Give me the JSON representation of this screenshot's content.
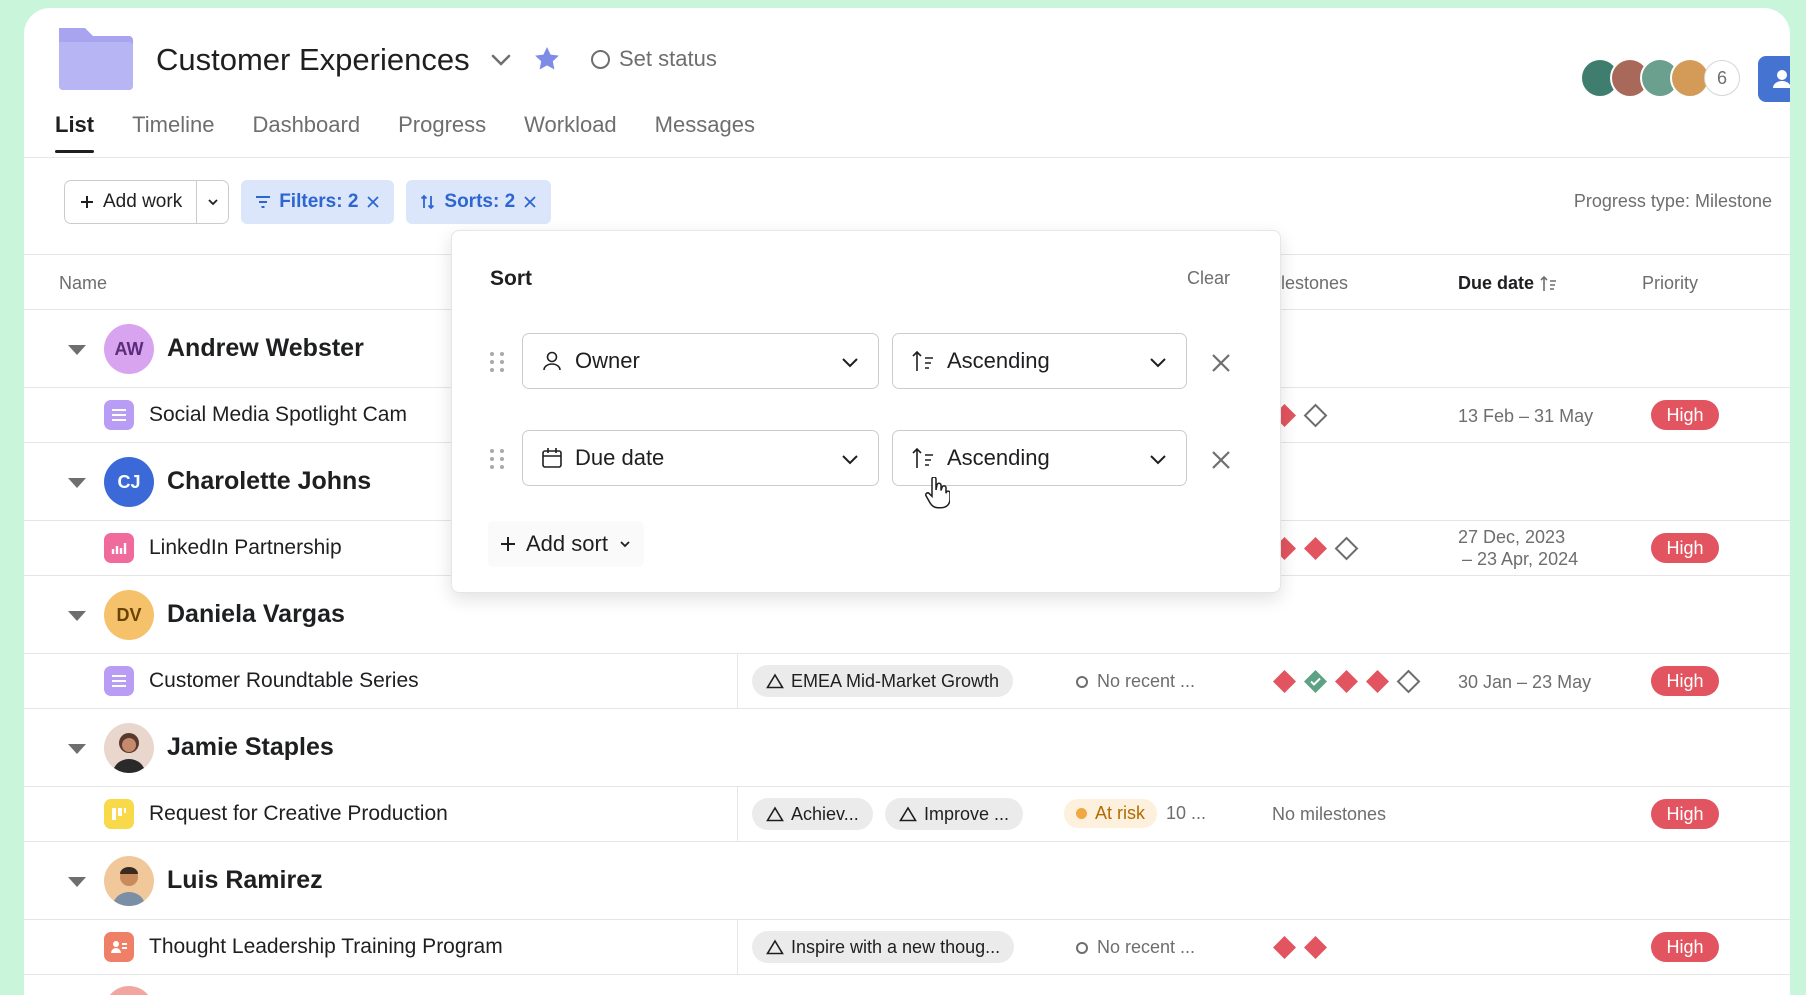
{
  "project": {
    "title": "Customer Experiences",
    "set_status": "Set status",
    "member_count": "6"
  },
  "tabs": [
    "List",
    "Timeline",
    "Dashboard",
    "Progress",
    "Workload",
    "Messages"
  ],
  "toolbar": {
    "add_work": "Add work",
    "filters": "Filters: 2",
    "sorts": "Sorts: 2",
    "progress_type": "Progress type: Milestone"
  },
  "columns": {
    "name": "Name",
    "milestones": "Milestones",
    "due_date": "Due date",
    "priority": "Priority"
  },
  "groups": [
    {
      "owner": "Andrew Webster",
      "initials": "AW",
      "task": {
        "name": "Social Media Spotlight Cam",
        "due": "13 Feb – 31 May",
        "due2": "",
        "priority": "High"
      }
    },
    {
      "owner": "Charolette Johns",
      "initials": "CJ",
      "task": {
        "name": "LinkedIn Partnership",
        "due": "27 Dec, 2023",
        "due2": "– 23 Apr, 2024",
        "priority": "High"
      }
    },
    {
      "owner": "Daniela Vargas",
      "initials": "DV",
      "task": {
        "name": "Customer Roundtable Series",
        "goal": "EMEA Mid-Market Growth",
        "status": "No recent ...",
        "due": "30 Jan – 23 May",
        "due2": "",
        "priority": "High"
      }
    },
    {
      "owner": "Jamie Staples",
      "initials": "",
      "task": {
        "name": "Request for Creative Production",
        "goal": "Achiev...",
        "goal2": "Improve ...",
        "status": "At risk",
        "status_extra": "10 ...",
        "milestones": "No milestones",
        "priority": "High"
      }
    },
    {
      "owner": "Luis Ramirez",
      "initials": "",
      "task": {
        "name": "Thought Leadership Training Program",
        "goal": "Inspire with a new thoug...",
        "status": "No recent ...",
        "priority": "High"
      }
    }
  ],
  "sort_popover": {
    "title": "Sort",
    "clear": "Clear",
    "rules": [
      {
        "field": "Owner",
        "direction": "Ascending"
      },
      {
        "field": "Due date",
        "direction": "Ascending"
      }
    ],
    "add_sort": "Add sort"
  },
  "colors": {
    "high": "#e2545f",
    "accent": "#2d66d1",
    "milestone_red": "#e2545f",
    "milestone_done": "#5da283"
  }
}
